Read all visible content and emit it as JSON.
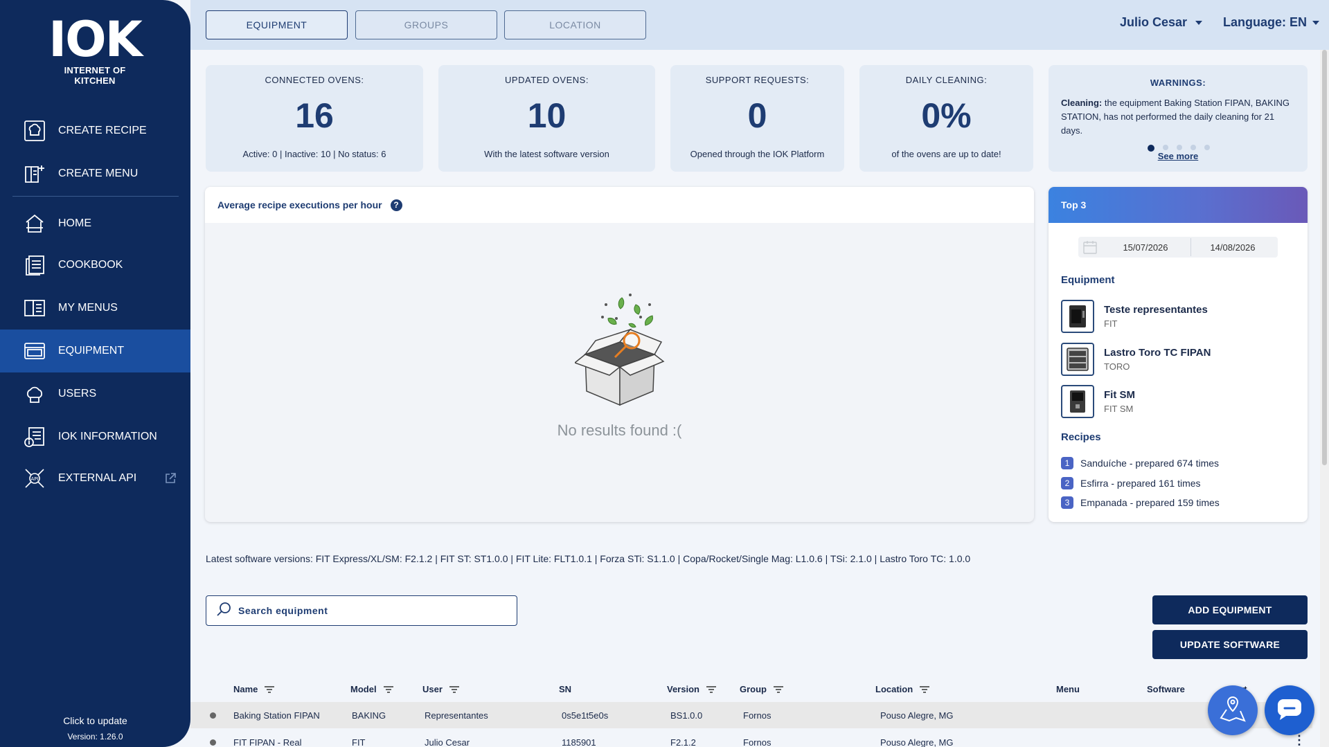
{
  "logo": {
    "mark": "IOK",
    "subtitle": "INTERNET OF KITCHEN"
  },
  "sidebar": {
    "items": [
      {
        "label": "CREATE RECIPE",
        "icon": "chef-hat-icon"
      },
      {
        "label": "CREATE MENU",
        "icon": "menu-add-icon"
      },
      {
        "label": "HOME",
        "icon": "home-icon"
      },
      {
        "label": "COOKBOOK",
        "icon": "cookbook-icon"
      },
      {
        "label": "MY MENUS",
        "icon": "open-book-icon"
      },
      {
        "label": "EQUIPMENT",
        "icon": "oven-icon",
        "active": true
      },
      {
        "label": "USERS",
        "icon": "users-icon"
      },
      {
        "label": "IOK INFORMATION",
        "icon": "info-doc-icon"
      },
      {
        "label": "EXTERNAL API",
        "icon": "api-icon"
      }
    ],
    "update_label": "Click to update",
    "version": "Version: 1.26.0"
  },
  "topbar": {
    "tabs": [
      "EQUIPMENT",
      "GROUPS",
      "LOCATION"
    ],
    "user": "Julio Cesar",
    "language": "Language: EN"
  },
  "stats": [
    {
      "title": "CONNECTED OVENS:",
      "value": "16",
      "sub": "Active: 0 | Inactive: 10 | No status: 6"
    },
    {
      "title": "UPDATED OVENS:",
      "value": "10",
      "sub": "With the latest software version"
    },
    {
      "title": "SUPPORT REQUESTS:",
      "value": "0",
      "sub": "Opened through the IOK Platform"
    },
    {
      "title": "DAILY CLEANING:",
      "value": "0%",
      "sub": "of the ovens are up to date!"
    }
  ],
  "warnings": {
    "title": "WARNINGS:",
    "label": "Cleaning:",
    "text": " the equipment Baking Station FIPAN, BAKING STATION, has not performed the daily cleaning for 21 days.",
    "see_more": "See more"
  },
  "chart": {
    "title": "Average recipe executions per hour",
    "help": "?",
    "empty": "No results found :("
  },
  "top3": {
    "title": "Top 3",
    "date_from": "15/07/2026",
    "date_to": "14/08/2026",
    "equipment_title": "Equipment",
    "equipment": [
      {
        "name": "Teste representantes",
        "model": "FIT"
      },
      {
        "name": "Lastro Toro TC FIPAN",
        "model": "TORO"
      },
      {
        "name": "Fit SM",
        "model": "FIT SM"
      }
    ],
    "recipes_title": "Recipes",
    "recipes": [
      {
        "rank": "1",
        "text": "Sanduíche - prepared 674 times"
      },
      {
        "rank": "2",
        "text": "Esfirra - prepared 161 times"
      },
      {
        "rank": "3",
        "text": "Empanada - prepared 159 times"
      }
    ]
  },
  "versions": "Latest software versions: FIT Express/XL/SM: F2.1.2 | FIT ST: ST1.0.0 | FIT Lite: FLT1.0.1 | Forza STi: S1.1.0 | Copa/Rocket/Single Mag: L1.0.6 | TSi: 2.1.0 | Lastro Toro TC: 1.0.0",
  "search": {
    "placeholder": "Search equipment"
  },
  "buttons": {
    "add": "ADD EQUIPMENT",
    "update": "UPDATE SOFTWARE"
  },
  "table": {
    "headers": [
      "Name",
      "Model",
      "User",
      "SN",
      "Version",
      "Group",
      "Location",
      "Menu",
      "Software",
      "Alert"
    ],
    "rows": [
      {
        "name": "Baking Station FIPAN",
        "model": "BAKING",
        "user": "Representantes",
        "sn": "0s5e1t5e0s",
        "version": "BS1.0.0",
        "group": "Fornos",
        "location": "Pouso Alegre, MG"
      },
      {
        "name": "FIT FIPAN - Real",
        "model": "FIT",
        "user": "Julio Cesar",
        "sn": "1185901",
        "version": "F2.1.2",
        "group": "Fornos",
        "location": "Pouso Alegre, MG"
      }
    ]
  },
  "colors": {
    "navy": "#0e2a5c",
    "accent": "#1e3c72",
    "active": "#1a4e9f",
    "fab_map": "#3a6fd8",
    "fab_chat": "#1e5fd0"
  }
}
